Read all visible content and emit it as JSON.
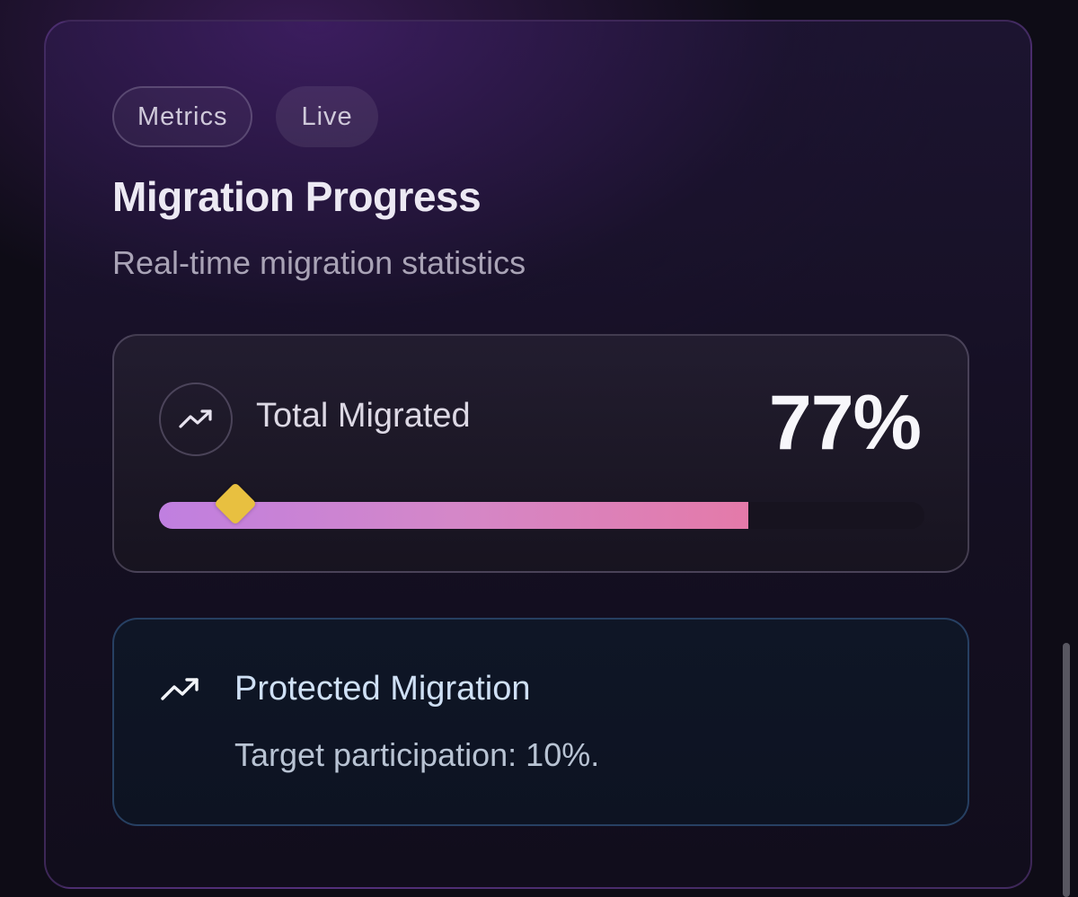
{
  "card": {
    "chips": [
      "Metrics",
      "Live"
    ],
    "title": "Migration Progress",
    "subtitle": "Real-time migration statistics"
  },
  "stat": {
    "icon": "trending-up-icon",
    "label": "Total Migrated",
    "value": "77%",
    "progress": 0.77,
    "target_marker": 0.1
  },
  "note": {
    "icon": "trending-up-icon",
    "title": "Protected Migration",
    "text": "Target participation: 10%."
  },
  "colors": {
    "accent_marker": "#e8c040",
    "bar_gradient_start": "#c07fe0",
    "bar_gradient_end": "#e47aa9"
  }
}
